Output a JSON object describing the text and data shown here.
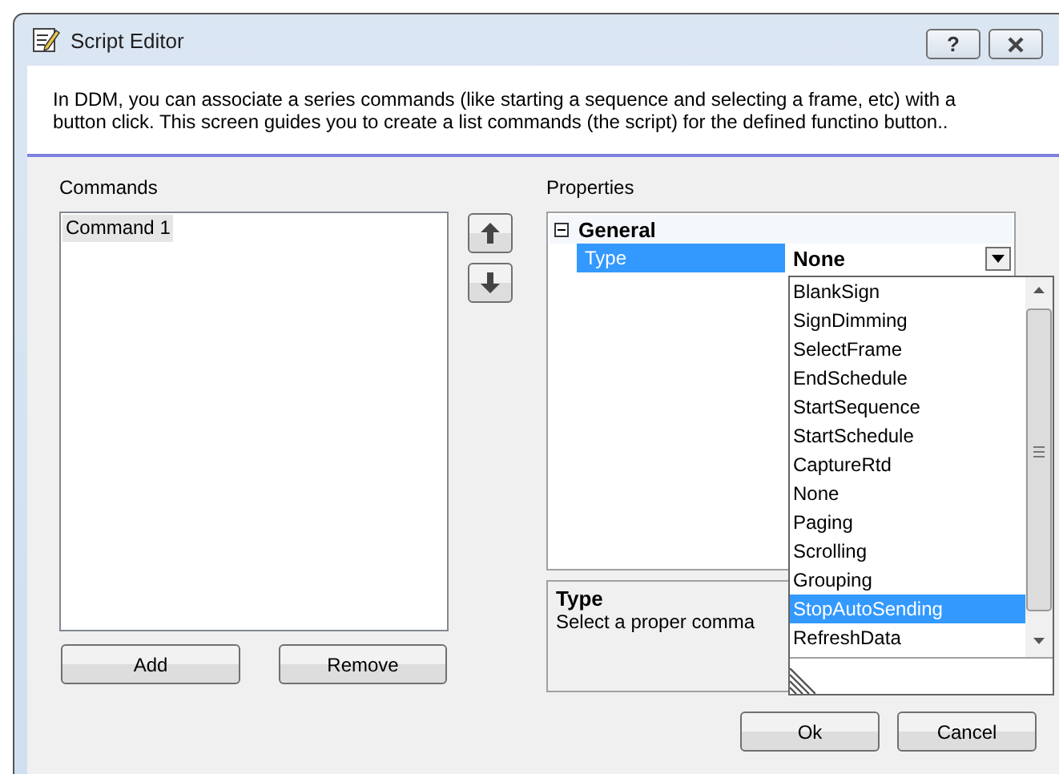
{
  "window": {
    "title": "Script Editor",
    "help_button": "?"
  },
  "description_lines": [
    "In DDM, you can associate a series commands (like starting a sequence and selecting a frame, etc) with a",
    "button click. This screen guides you to create a list commands (the script) for the defined functino button.."
  ],
  "commands": {
    "label": "Commands",
    "items": [
      {
        "label": "Command 1",
        "selected": true
      }
    ],
    "buttons": [
      "Add",
      "Remove"
    ]
  },
  "properties": {
    "label": "Properties",
    "category": {
      "label": "General",
      "expanded": true
    },
    "property": {
      "name": "Type",
      "value": "None",
      "selected": true
    },
    "dropdown": {
      "items": [
        {
          "label": "BlankSign",
          "selected": false
        },
        {
          "label": "SignDimming",
          "selected": false
        },
        {
          "label": "SelectFrame",
          "selected": false
        },
        {
          "label": "EndSchedule",
          "selected": false
        },
        {
          "label": "StartSequence",
          "selected": false
        },
        {
          "label": "StartSchedule",
          "selected": false
        },
        {
          "label": "CaptureRtd",
          "selected": false
        },
        {
          "label": "None",
          "selected": false
        },
        {
          "label": "Paging",
          "selected": false
        },
        {
          "label": "Scrolling",
          "selected": false
        },
        {
          "label": "Grouping",
          "selected": false
        },
        {
          "label": "StopAutoSending",
          "selected": true
        },
        {
          "label": "RefreshData",
          "selected": false
        }
      ]
    },
    "help": {
      "title": "Type",
      "text": "Select a proper comma"
    }
  },
  "buttons": [
    "Ok",
    "Cancel"
  ]
}
